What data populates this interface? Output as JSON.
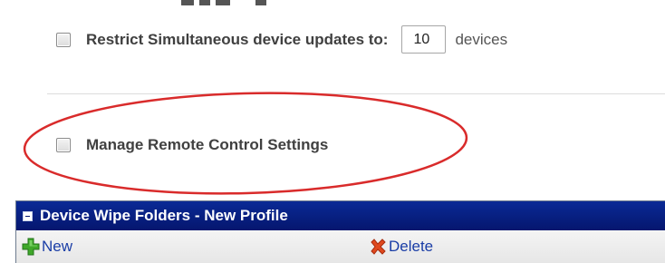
{
  "throttle": {
    "checkbox_label": "Restrict Simultaneous device updates to:",
    "limit_value": "10",
    "unit": "devices"
  },
  "remote_control": {
    "checkbox_label": "Manage Remote Control Settings"
  },
  "annotation": {
    "color": "#d92b2b",
    "shape": "ellipse"
  },
  "panel": {
    "title": "Device Wipe Folders - New Profile",
    "header_color": "#0a2a96",
    "toolbar": {
      "new_label": "New",
      "new_icon": "plus-icon",
      "delete_label": "Delete",
      "delete_icon": "x-icon"
    }
  }
}
